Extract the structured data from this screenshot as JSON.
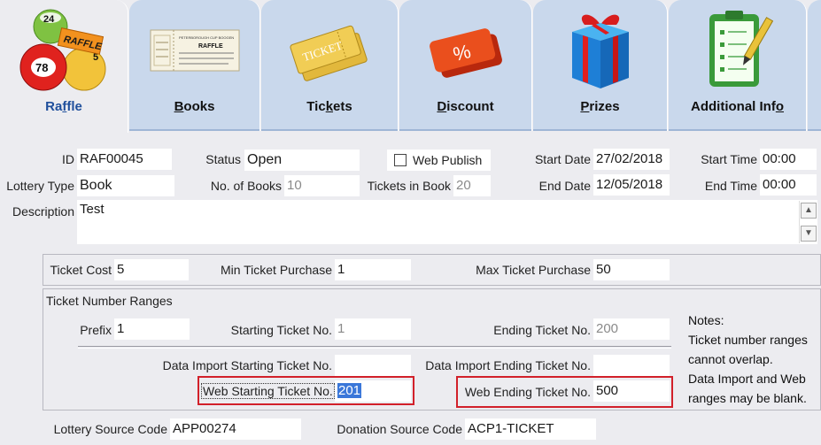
{
  "tabs": [
    {
      "label_pre": "Ra",
      "label_u": "f",
      "label_post": "fle",
      "icon": "raffle-balls-icon",
      "active": true
    },
    {
      "label_pre": "",
      "label_u": "B",
      "label_post": "ooks",
      "icon": "books-icon",
      "active": false
    },
    {
      "label_pre": "Tic",
      "label_u": "k",
      "label_post": "ets",
      "icon": "tickets-icon",
      "active": false
    },
    {
      "label_pre": "",
      "label_u": "D",
      "label_post": "iscount",
      "icon": "discount-icon",
      "active": false
    },
    {
      "label_pre": "",
      "label_u": "P",
      "label_post": "rizes",
      "icon": "gift-icon",
      "active": false
    },
    {
      "label_pre": "Additional Inf",
      "label_u": "o",
      "label_post": "",
      "icon": "clipboard-icon",
      "active": false
    }
  ],
  "raffle_ball_texts": {
    "a": "24",
    "b": "RAFFLE",
    "c": "78",
    "d": "5"
  },
  "book_icon_text": {
    "line1": "PETERBOROUGH CUP BOOGEN",
    "line2": "RAFFLE"
  },
  "ticket_icon_text": "TICKET",
  "discount_icon_text": "%",
  "form": {
    "id_label": "ID",
    "id_value": "RAF00045",
    "status_label": "Status",
    "status_value": "Open",
    "web_publish_label": "Web Publish",
    "start_date_label": "Start Date",
    "start_date_value": "27/02/2018",
    "start_time_label": "Start Time",
    "start_time_value": "00:00",
    "lottery_type_label": "Lottery Type",
    "lottery_type_value": "Book",
    "no_books_label": "No. of Books",
    "no_books_value": "10",
    "tickets_in_book_label": "Tickets in Book",
    "tickets_in_book_value": "20",
    "end_date_label": "End Date",
    "end_date_value": "12/05/2018",
    "end_time_label": "End Time",
    "end_time_value": "00:00",
    "description_label": "Description",
    "description_value": "Test",
    "ticket_cost_label": "Ticket Cost",
    "ticket_cost_value": "5",
    "min_purchase_label": "Min Ticket Purchase",
    "min_purchase_value": "1",
    "max_purchase_label": "Max Ticket Purchase",
    "max_purchase_value": "50",
    "ranges_title": "Ticket Number Ranges",
    "prefix_label": "Prefix",
    "prefix_value": "1",
    "starting_label": "Starting Ticket No.",
    "starting_value": "1",
    "ending_label": "Ending Ticket No.",
    "ending_value": "200",
    "di_start_label": "Data Import Starting Ticket No.",
    "di_start_value": "",
    "di_end_label": "Data Import Ending Ticket No.",
    "di_end_value": "",
    "web_start_label": "Web Starting Ticket No.",
    "web_start_value": "201",
    "web_end_label": "Web Ending Ticket No.",
    "web_end_value": "500",
    "notes": [
      "Notes:",
      "Ticket number ranges",
      "cannot overlap.",
      "Data Import and Web",
      "ranges may be blank."
    ],
    "lottery_source_label": "Lottery Source Code",
    "lottery_source_value": "APP00274",
    "donation_source_label": "Donation Source Code",
    "donation_source_value": "ACP1-TICKET"
  },
  "colors": {
    "tab_bg": "#c9d8ec",
    "active_tab_text": "#1f4f9c",
    "highlight_red": "#d2202a",
    "selection": "#3a77d9"
  }
}
